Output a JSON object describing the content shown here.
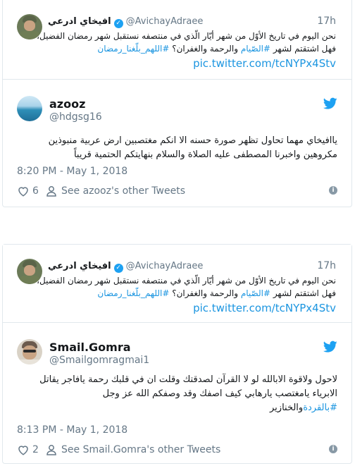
{
  "colors": {
    "link": "#1b95e0",
    "twitter_blue": "#1da1f2",
    "muted": "#657786",
    "border": "#e1e8ed"
  },
  "tweets": [
    {
      "quoted": {
        "name": "افيخاي ادرعي",
        "handle": "@AvichayAdraee",
        "time": "17h",
        "text_plain_1": "نحن اليوم في تاريخ الأوّل من شهر أيّار الّذي في منتصفه نستقبل شهر رمضان الفضيل،",
        "text_plain_2": "فهل اشتقتم لشهر ",
        "hashtag_1": "#الصّيام",
        "text_plain_3": " والرحمة والغفران؟ ",
        "hashtag_2": "#اللهم_بلّغنا_رمضان",
        "link": "pic.twitter.com/tcNYPx4Stv"
      },
      "author_name": "azooz",
      "author_handle": "@hdgsg16",
      "text": "ياافيخاي مهما تحاول تظهر صورة حسنه الا انكم مغتصبين ارض عربية منبوذين مكروهين واخبرنا المصطفى عليه الصلاة والسلام بنهايتكم الحتمية قريباً",
      "timestamp": "8:20 PM - May 1, 2018",
      "likes": "6",
      "others_label": "See azooz's other Tweets",
      "avatar_icon": "sea-photo-avatar"
    },
    {
      "quoted": {
        "name": "افيخاي ادرعي",
        "handle": "@AvichayAdraee",
        "time": "17h",
        "text_plain_1": "نحن اليوم في تاريخ الأوّل من شهر أيّار الّذي في منتصفه نستقبل شهر رمضان الفضيل،",
        "text_plain_2": "فهل اشتقتم لشهر ",
        "hashtag_1": "#الصّيام",
        "text_plain_3": " والرحمة والغفران؟ ",
        "hashtag_2": "#اللهم_بلّغنا_رمضان",
        "link": "pic.twitter.com/tcNYPx4Stv"
      },
      "author_name": "Smail.Gomra",
      "author_handle": "@Smailgomragmai1",
      "text_1": "لاحول ولاقوة الابالله لو لا القرآن لصدقتك وقلت ان في قلبك رحمة يافاجر يقاتل الابرياء يامغتصب يارهابي كيف اصفك وقد وصفكم الله عز وجل",
      "text_hashtag": "#بالقردة",
      "text_2": "والخنازير",
      "timestamp": "8:13 PM - May 1, 2018",
      "likes": "2",
      "others_label": "See Smail.Gomra's other Tweets",
      "avatar_icon": "man-with-glasses-avatar"
    }
  ]
}
